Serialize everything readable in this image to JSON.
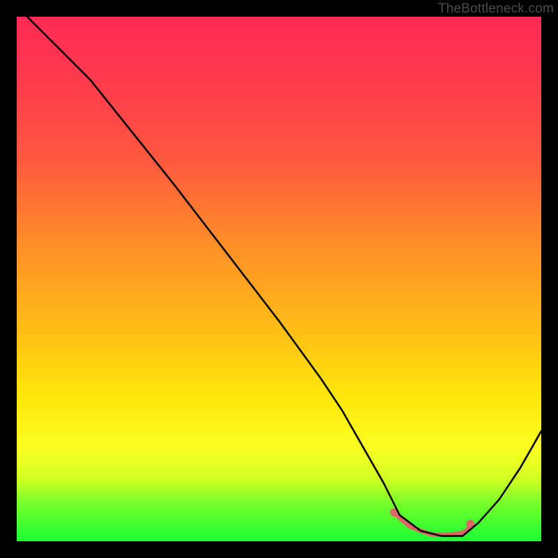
{
  "attribution": "TheBottleneck.com",
  "chart_data": {
    "type": "line",
    "title": "",
    "xlabel": "",
    "ylabel": "",
    "xlim": [
      0,
      100
    ],
    "ylim": [
      0,
      100
    ],
    "grid": false,
    "series": [
      {
        "name": "bottleneck-curve",
        "x": [
          2,
          4,
          8,
          14,
          22,
          30,
          40,
          50,
          58,
          62,
          66,
          70,
          73,
          77,
          81,
          85,
          88,
          92,
          96,
          100
        ],
        "y": [
          100,
          98,
          94,
          88,
          78,
          68,
          55,
          42,
          31,
          25,
          18,
          11,
          5,
          2,
          1,
          1,
          3.5,
          8,
          14,
          21
        ]
      }
    ],
    "flat_segment": {
      "name": "highlighted-flat-region",
      "x": [
        72,
        73.5,
        75,
        77,
        79,
        81,
        83,
        85,
        86,
        86.5
      ],
      "y": [
        5.5,
        4,
        2.8,
        2,
        1.3,
        1.2,
        1.3,
        1.6,
        2.2,
        3.3
      ],
      "color": "#d86a66",
      "stroke_width": 6.5
    }
  }
}
